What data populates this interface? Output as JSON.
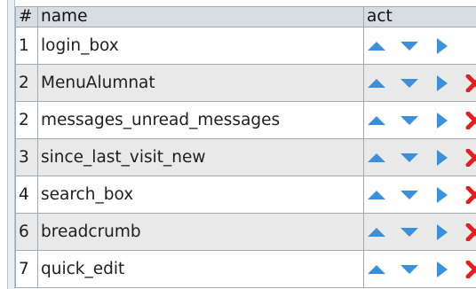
{
  "table": {
    "columns": [
      "#",
      "name",
      "act"
    ],
    "rows": [
      {
        "num": "1",
        "name": "login_box",
        "actions": [
          "move-up-icon",
          "move-down-icon",
          "move-right-icon"
        ]
      },
      {
        "num": "2",
        "name": "MenuAlumnat",
        "actions": [
          "move-up-icon",
          "move-down-icon",
          "move-right-icon",
          "delete-icon"
        ]
      },
      {
        "num": "2",
        "name": "messages_unread_messages",
        "actions": [
          "move-up-icon",
          "move-down-icon",
          "move-right-icon",
          "delete-icon"
        ]
      },
      {
        "num": "3",
        "name": "since_last_visit_new",
        "actions": [
          "move-up-icon",
          "move-down-icon",
          "move-right-icon",
          "delete-icon"
        ]
      },
      {
        "num": "4",
        "name": "search_box",
        "actions": [
          "move-up-icon",
          "move-down-icon",
          "move-right-icon",
          "delete-icon"
        ]
      },
      {
        "num": "6",
        "name": "breadcrumb",
        "actions": [
          "move-up-icon",
          "move-down-icon",
          "move-right-icon",
          "delete-icon"
        ]
      },
      {
        "num": "7",
        "name": "quick_edit",
        "actions": [
          "move-up-icon",
          "move-down-icon",
          "move-right-icon",
          "delete-icon"
        ]
      }
    ]
  },
  "colors": {
    "arrow_blue": "#3c8fd8",
    "delete_red": "#e02020",
    "header_bg": "#d8dde1",
    "row_alt_bg": "#e9e9e9",
    "border": "#9faab3"
  }
}
